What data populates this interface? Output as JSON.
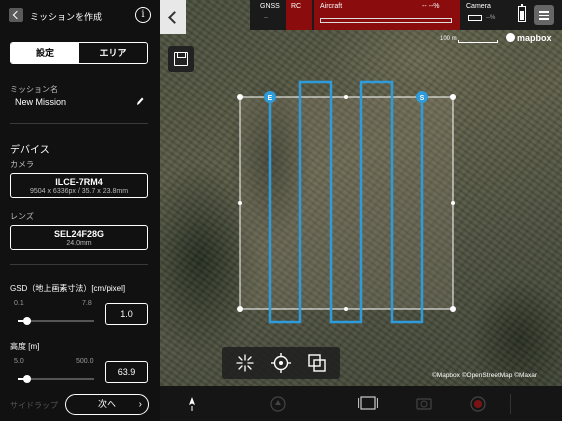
{
  "header": {
    "title": "ミッションを作成",
    "back_icon": "chevron-left-icon",
    "info_icon": "info-icon",
    "info_glyph": "i"
  },
  "tabs": [
    {
      "label": "設定",
      "active": true
    },
    {
      "label": "エリア",
      "active": false
    }
  ],
  "mission": {
    "label": "ミッション名",
    "value": "New Mission"
  },
  "device": {
    "title": "デバイス",
    "camera_label": "カメラ",
    "camera_name": "ILCE-7RM4",
    "camera_spec": "9504 x 6336px / 35.7 x 23.8mm",
    "lens_label": "レンズ",
    "lens_name": "SEL24F28G",
    "lens_spec": "24.0mm"
  },
  "gsd": {
    "label": "GSD（地上画素寸法）[cm/pixel]",
    "min": "0.1",
    "max": "7.8",
    "value": "1.0",
    "fraction": 0.12
  },
  "altitude": {
    "label": "高度 [m]",
    "min": "5.0",
    "max": "500.0",
    "value": "63.9",
    "fraction": 0.12
  },
  "footer": {
    "faded_label": "サイドラップ",
    "next_label": "次へ",
    "next_chevron": "›"
  },
  "top_bar": {
    "gnss_label": "GNSS",
    "gnss_value": "--",
    "rc_label": "RC",
    "aircraft_label": "Aircraft",
    "aircraft_value": "-- --%",
    "camera_label": "Camera",
    "camera_value": "--%"
  },
  "map": {
    "scale_label": "100 m",
    "logo": "mapbox",
    "attribution": "©Mapbox ©OpenStreetMap ©Maxar",
    "marker_start": "S",
    "marker_end": "E"
  },
  "colors": {
    "accent": "#2e9bdb",
    "alert": "#8a0c0c",
    "panel": "#111111"
  }
}
